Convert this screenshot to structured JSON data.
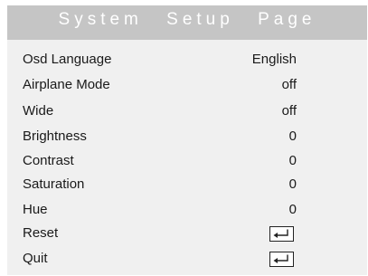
{
  "title": "System Setup Page",
  "menu": {
    "items": [
      {
        "label": "Osd Language",
        "value": "English"
      },
      {
        "label": "Airplane Mode",
        "value": "off"
      },
      {
        "label": "Wide",
        "value": "off"
      },
      {
        "label": "Brightness",
        "value": "0"
      },
      {
        "label": "Contrast",
        "value": "0"
      },
      {
        "label": "Saturation",
        "value": "0"
      },
      {
        "label": "Hue",
        "value": "0"
      },
      {
        "label": "Reset",
        "action_icon": "enter-return-icon"
      },
      {
        "label": "Quit",
        "action_icon": "enter-return-icon"
      }
    ]
  },
  "colors": {
    "title_bar": "#c5c5c5",
    "title_text": "#ffffff",
    "menu_background": "#f0f0f0",
    "text": "#1a1a1a"
  }
}
